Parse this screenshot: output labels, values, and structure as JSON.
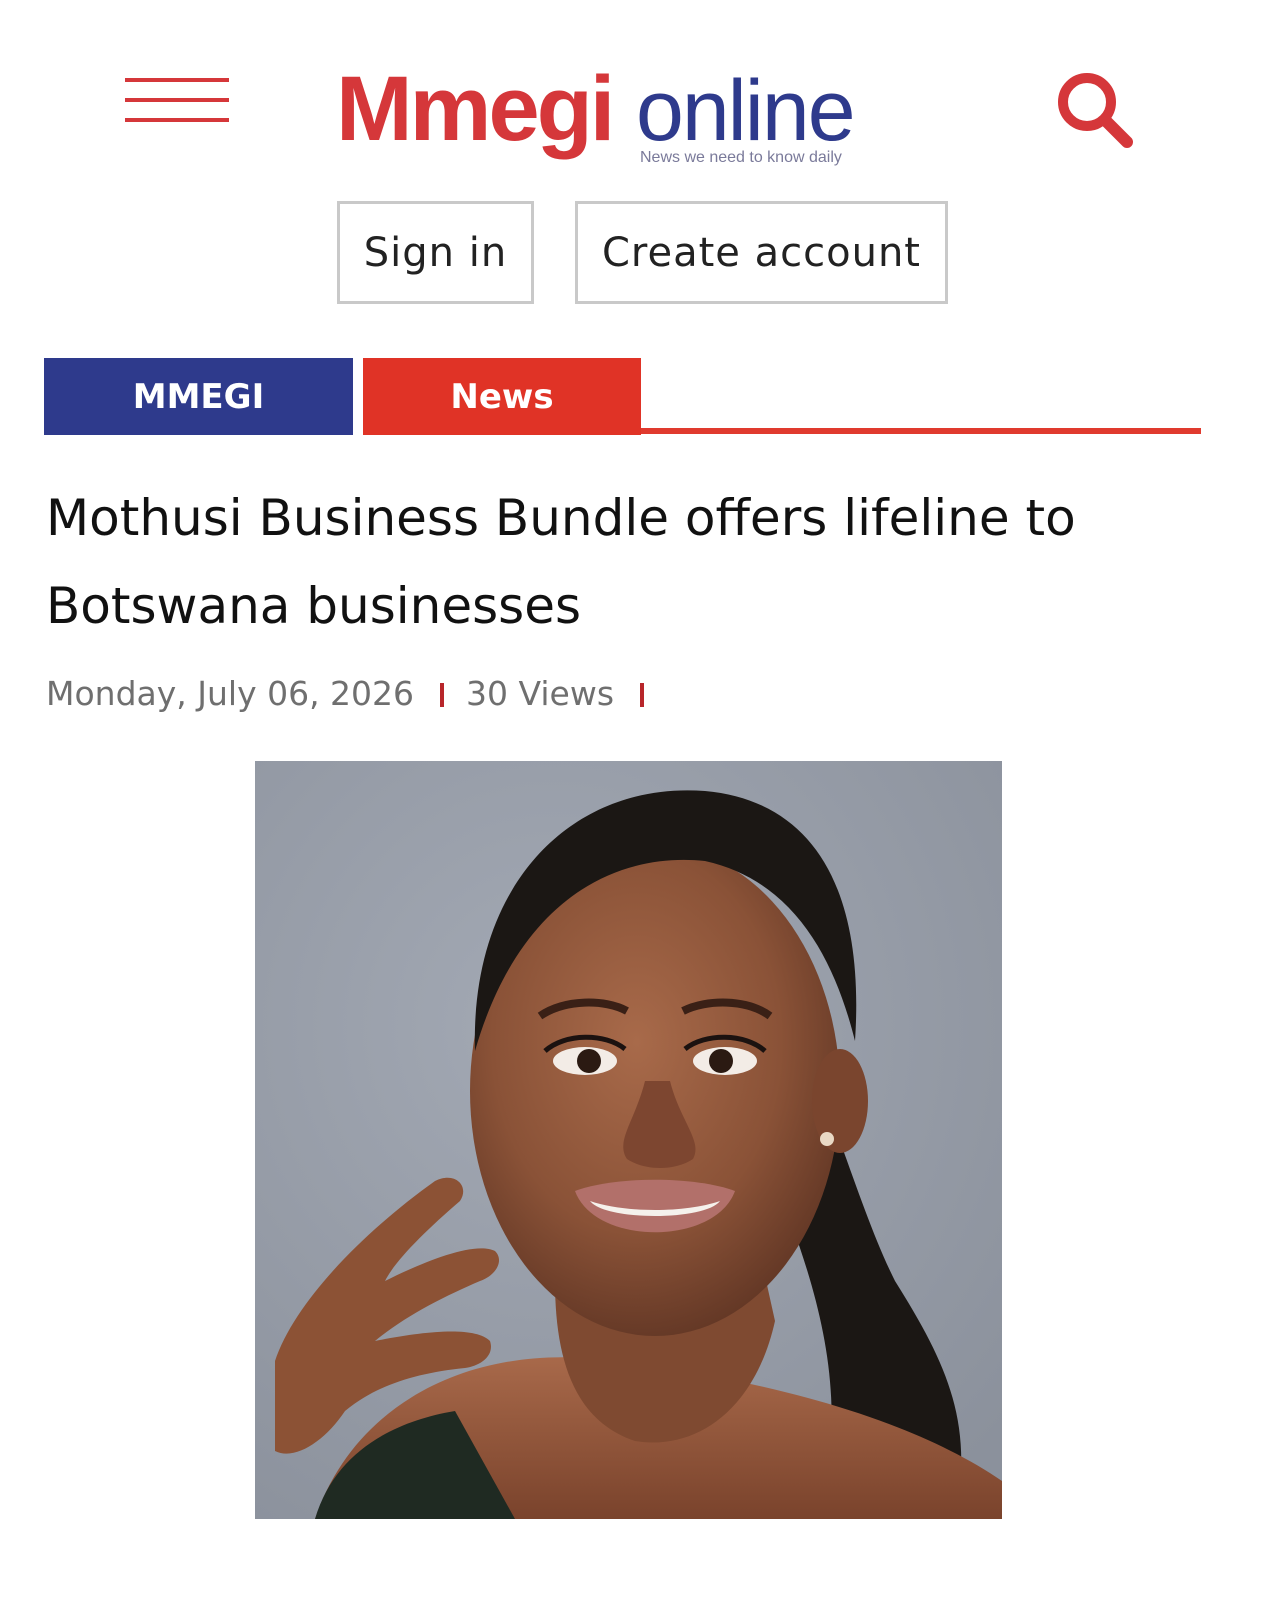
{
  "header": {
    "menu_icon": "hamburger-menu-icon",
    "logo": {
      "brand_primary": "Mmegi",
      "brand_secondary": "online",
      "tagline": "News we need to know daily"
    },
    "search_icon": "search-icon"
  },
  "auth": {
    "sign_in_label": "Sign in",
    "create_account_label": "Create account"
  },
  "categories": [
    {
      "label": "MMEGI",
      "color": "#2e3a8c"
    },
    {
      "label": "News",
      "color": "#e03326"
    }
  ],
  "article": {
    "title": "Mothusi Business Bundle offers lifeline to Botswana businesses",
    "date": "Monday, July 06, 2026",
    "views": "30 Views",
    "image": "portrait photo of a smiling woman"
  },
  "colors": {
    "brand_red": "#d5373a",
    "brand_blue": "#2e3a8c",
    "accent_red": "#e03326"
  }
}
